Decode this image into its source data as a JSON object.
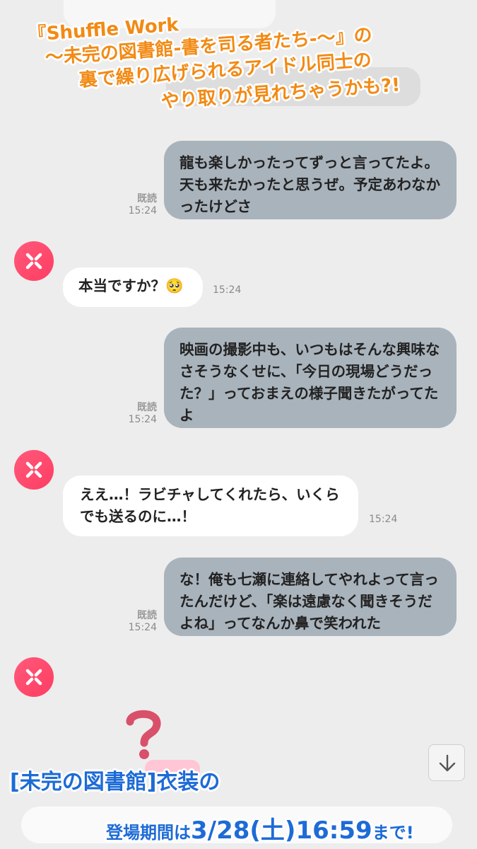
{
  "promo": {
    "title_lines": [
      "『Shuffle Work",
      "〜未完の図書館-書を司る者たち-〜』の",
      "裏で繰り広げられるアイドル同士の",
      "やり取りが見れちゃうかも?!"
    ],
    "footer_line1": "[未完の図書館]衣装の",
    "footer_line2_prefix": "登場期間は",
    "footer_line2_date": "3/28(土)16:59",
    "footer_line2_suffix": "まで!"
  },
  "chat": {
    "messages": [
      {
        "side": "outgoing",
        "lines": [
          "龍も楽しかったってずっと言ってたよ。",
          "天も来たかったと思うぜ。予定あわなか",
          "ったけどさ"
        ],
        "read": "既読",
        "time": "15:24"
      },
      {
        "side": "incoming",
        "lines": [
          "本当ですか？🥺"
        ],
        "time": "15:24"
      },
      {
        "side": "outgoing",
        "lines": [
          "映画の撮影中も、いつもはそんな興味な",
          "さそうなくせに、「今日の現場どうだっ",
          "た？」っておまえの様子聞きたがってた",
          "よ"
        ],
        "read": "既読",
        "time": "15:24"
      },
      {
        "side": "incoming",
        "lines": [
          "ええ…！ラビチャしてくれたら、いくら",
          "でも送るのに…！"
        ],
        "time": "15:24"
      },
      {
        "side": "outgoing",
        "lines": [
          "な！俺も七瀬に連絡してやれよって言っ",
          "たんだけど、「楽は遠慮なく聞きそうだ",
          "よね」ってなんか鼻で笑われた"
        ],
        "read": "既読",
        "time": "15:24"
      }
    ]
  },
  "icons": {
    "avatar": "sprite-badge-icon",
    "scroll_down": "arrow-down-icon",
    "question": "question-mark-icon"
  },
  "colors": {
    "outgoing_bubble": "#a9b3bc",
    "incoming_bubble": "#ffffff",
    "avatar": "#ff4a6d",
    "title": "#f28a14",
    "footer": "#1d6bd6"
  }
}
